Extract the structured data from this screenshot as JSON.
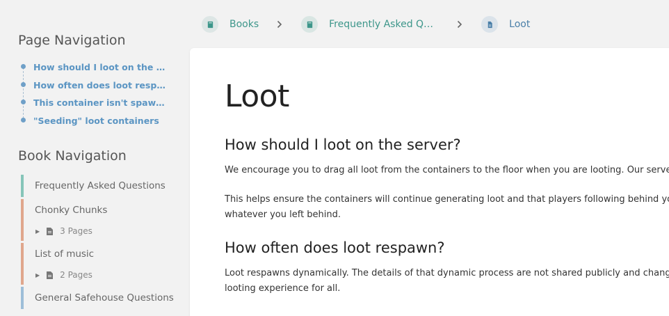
{
  "breadcrumb": {
    "items": [
      {
        "label": "Books",
        "icon": "book-icon"
      },
      {
        "label": "Frequently Asked Quest...",
        "icon": "book-icon"
      },
      {
        "label": "Loot",
        "icon": "page-icon"
      }
    ],
    "separator": ">"
  },
  "page_navigation": {
    "title": "Page Navigation",
    "items": [
      "How should I loot on the ser...",
      "How often does loot respawn?",
      "This container isn't spawnin...",
      "\"Seeding\" loot containers"
    ]
  },
  "book_navigation": {
    "title": "Book Navigation",
    "chapters": [
      {
        "label": "Frequently Asked Questions",
        "color": "#86c5b9"
      },
      {
        "label": "Chonky Chunks",
        "pages": "3 Pages",
        "color": "#e0a68c"
      },
      {
        "label": "List of music",
        "pages": "2 Pages",
        "color": "#e0a68c"
      },
      {
        "label": "General Safehouse Questions",
        "color": "#9ebed8"
      }
    ]
  },
  "main": {
    "title": "Loot",
    "sections": [
      {
        "heading": "How should I loot on the server?",
        "paragraphs": [
          "We encourage you to drag all loot from the containers to the floor when you are looting. Our server clea",
          "This helps ensure the containers will continue generating loot and that players following behind you hav",
          "whatever you left behind."
        ]
      },
      {
        "heading": "How often does loot respawn?",
        "paragraphs": [
          "Loot respawns dynamically. The details of that dynamic process are not shared publicly and change peri",
          "looting experience for all."
        ]
      }
    ]
  },
  "colors": {
    "accent_teal": "#3d968a",
    "accent_blue": "#5b95c3"
  }
}
